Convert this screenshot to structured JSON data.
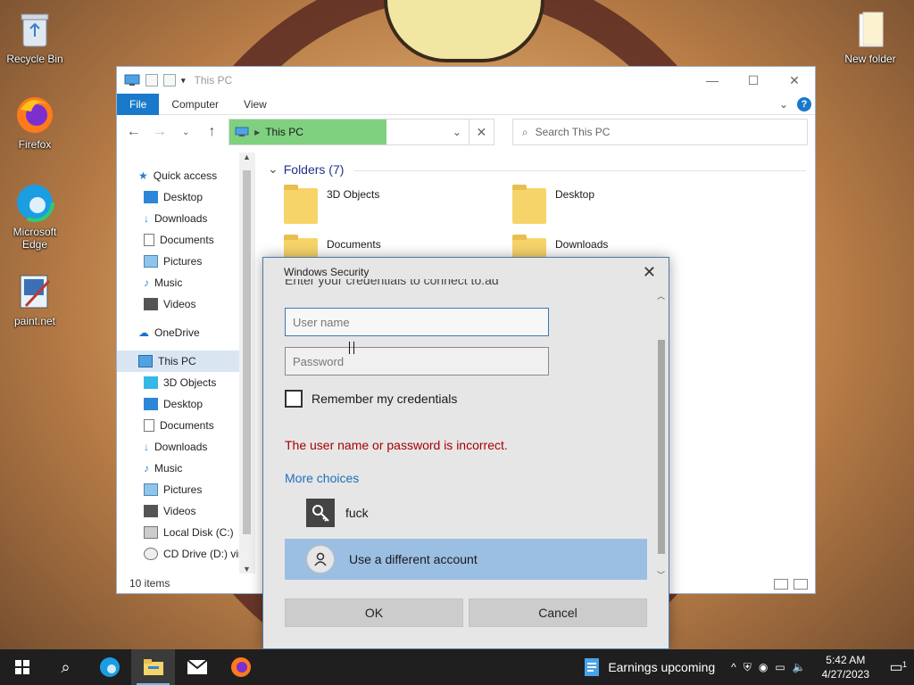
{
  "desktop": {
    "icons": [
      {
        "label": "Recycle Bin"
      },
      {
        "label": "Firefox"
      },
      {
        "label": "Microsoft Edge"
      },
      {
        "label": "paint.net"
      },
      {
        "label": "New folder"
      }
    ]
  },
  "explorer": {
    "title": "This PC",
    "ribbon": {
      "tabs": [
        "File",
        "Computer",
        "View"
      ]
    },
    "address": {
      "location": "This PC",
      "search_placeholder": "Search This PC"
    },
    "nav": {
      "quick_access": "Quick access",
      "quick_items": [
        "Desktop",
        "Downloads",
        "Documents",
        "Pictures",
        "Music",
        "Videos"
      ],
      "onedrive": "OneDrive",
      "this_pc": "This PC",
      "pc_items": [
        "3D Objects",
        "Desktop",
        "Documents",
        "Downloads",
        "Music",
        "Pictures",
        "Videos",
        "Local Disk (C:)",
        "CD Drive (D:) virt"
      ]
    },
    "content": {
      "group_header": "Folders (7)",
      "folders": [
        "3D Objects",
        "Desktop",
        "Documents",
        "Downloads"
      ]
    },
    "status": "10 items"
  },
  "dialog": {
    "title": "Windows Security",
    "cut_text": "Enter your credentials to connect to:ad",
    "username_placeholder": "User name",
    "password_placeholder": "Password",
    "remember_label": "Remember my credentials",
    "error": "The user name or password is incorrect.",
    "more_choices": "More choices",
    "saved_credential": "fuck",
    "different_account": "Use a different account",
    "ok": "OK",
    "cancel": "Cancel"
  },
  "taskbar": {
    "weather": "Earnings upcoming",
    "time": "5:42 AM",
    "date": "4/27/2023",
    "notification_count": "1"
  },
  "colors": {
    "accent": "#1979ca",
    "error": "#a80000",
    "link": "#1c6fbe",
    "selection": "#9bbfe3"
  }
}
